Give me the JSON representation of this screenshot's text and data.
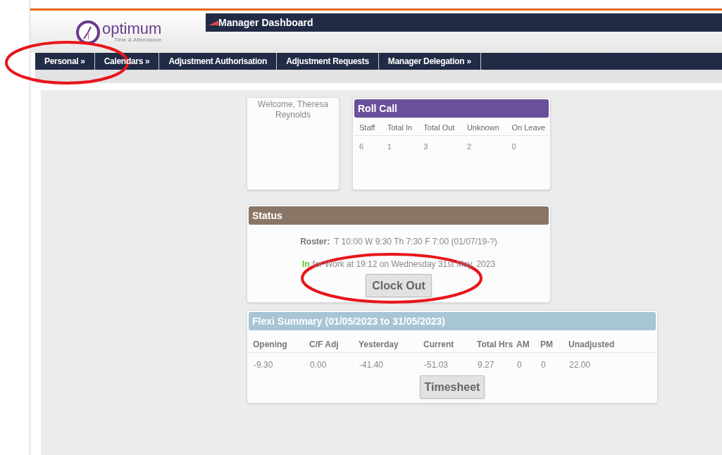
{
  "header": {
    "logo_word": "optimum",
    "logo_tagline": "Time & Attendance",
    "title": "Manager Dashboard"
  },
  "nav": [
    {
      "label": "Personal »"
    },
    {
      "label": "Calendars »"
    },
    {
      "label": "Adjustment Authorisation"
    },
    {
      "label": "Adjustment Requests"
    },
    {
      "label": "Manager Delegation »"
    }
  ],
  "welcome": "Welcome, Theresa Reynolds",
  "roll_call": {
    "title": "Roll Call",
    "columns": [
      "Staff",
      "Total In",
      "Total Out",
      "Unknown",
      "On Leave"
    ],
    "values": [
      "6",
      "1",
      "3",
      "2",
      "0"
    ]
  },
  "status": {
    "title": "Status",
    "roster_label": "Roster:",
    "roster_value": "T 10:00 W 9:30 Th 7:30 F 7:00 (01/07/19-?)",
    "state": "In",
    "state_text": "for Work at 19:12 on Wednesday 31st May, 2023",
    "button": "Clock Out"
  },
  "flexi": {
    "title": "Flexi Summary (01/05/2023 to 31/05/2023)",
    "columns": [
      "Opening",
      "C/F Adj",
      "Yesterday",
      "Current",
      "Total Hrs",
      "AM",
      "PM",
      "Unadjusted"
    ],
    "values": [
      "-9.30",
      "0.00",
      "-41.40",
      "-51.03",
      "9.27",
      "0",
      "0",
      "22.00"
    ],
    "button": "Timesheet"
  }
}
